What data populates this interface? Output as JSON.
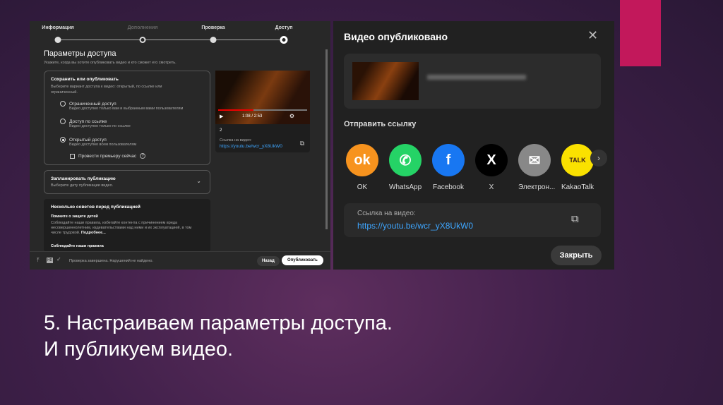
{
  "left": {
    "steps": [
      {
        "label": "Информация",
        "state": "done"
      },
      {
        "label": "Дополнения",
        "state": "dim"
      },
      {
        "label": "Проверка",
        "state": "done"
      },
      {
        "label": "Доступ",
        "state": "current"
      }
    ],
    "title": "Параметры доступа",
    "subtitle": "Укажите, когда вы хотите опубликовать видео и кто сможет его смотреть.",
    "save_title": "Сохранить или опубликовать",
    "save_desc": "Выберите вариант доступа к видео: открытый, по ссылке или ограниченный.",
    "options": [
      {
        "label": "Ограниченный доступ",
        "desc": "Видео доступно только вам и выбранным вами пользователям",
        "selected": false
      },
      {
        "label": "Доступ по ссылке",
        "desc": "Видео доступно только по ссылке",
        "selected": false
      },
      {
        "label": "Открытый доступ",
        "desc": "Видео доступно всем пользователям",
        "selected": true
      }
    ],
    "premiere": "Провести премьеру сейчас",
    "time": "1:08 / 2:53",
    "video_title": "2",
    "link_label": "Ссылка на видео:",
    "link": "https://youtu.be/wcr_yX8UkW0",
    "schedule_title": "Запланировать публикацию",
    "schedule_desc": "Выберите дату публикации видео.",
    "tips_title": "Несколько советов перед публикацией",
    "tip1_title": "Помните о защите детей",
    "tip1_text": "Соблюдайте наши правила, избегайте контента с причинением вреда несовершеннолетним, издевательствами над ними и их эксплуатацией, в том числе трудовой.",
    "tip1_more": "Подробнее...",
    "tip2_title": "Соблюдайте наши правила",
    "status": "Проверка завершена. Нарушений не найдено.",
    "hd": "HD",
    "back": "Назад",
    "publish": "Опубликовать"
  },
  "right": {
    "title": "Видео опубликовано",
    "share_title": "Отправить ссылку",
    "share": [
      {
        "label": "OK",
        "color": "#f7931e",
        "glyph": "ok"
      },
      {
        "label": "WhatsApp",
        "color": "#25d366",
        "glyph": "✆"
      },
      {
        "label": "Facebook",
        "color": "#1877f2",
        "glyph": "f"
      },
      {
        "label": "X",
        "color": "#000000",
        "glyph": "X"
      },
      {
        "label": "Электрон...",
        "color": "#888888",
        "glyph": "✉"
      },
      {
        "label": "KakaoTalk",
        "color": "#fae100",
        "glyph": "TALK"
      }
    ],
    "link_label": "Ссылка на видео:",
    "link": "https://youtu.be/wcr_yX8UkW0",
    "close": "Закрыть"
  },
  "caption": {
    "line1": "5. Настраиваем параметры доступа.",
    "line2": "И публикуем видео."
  }
}
